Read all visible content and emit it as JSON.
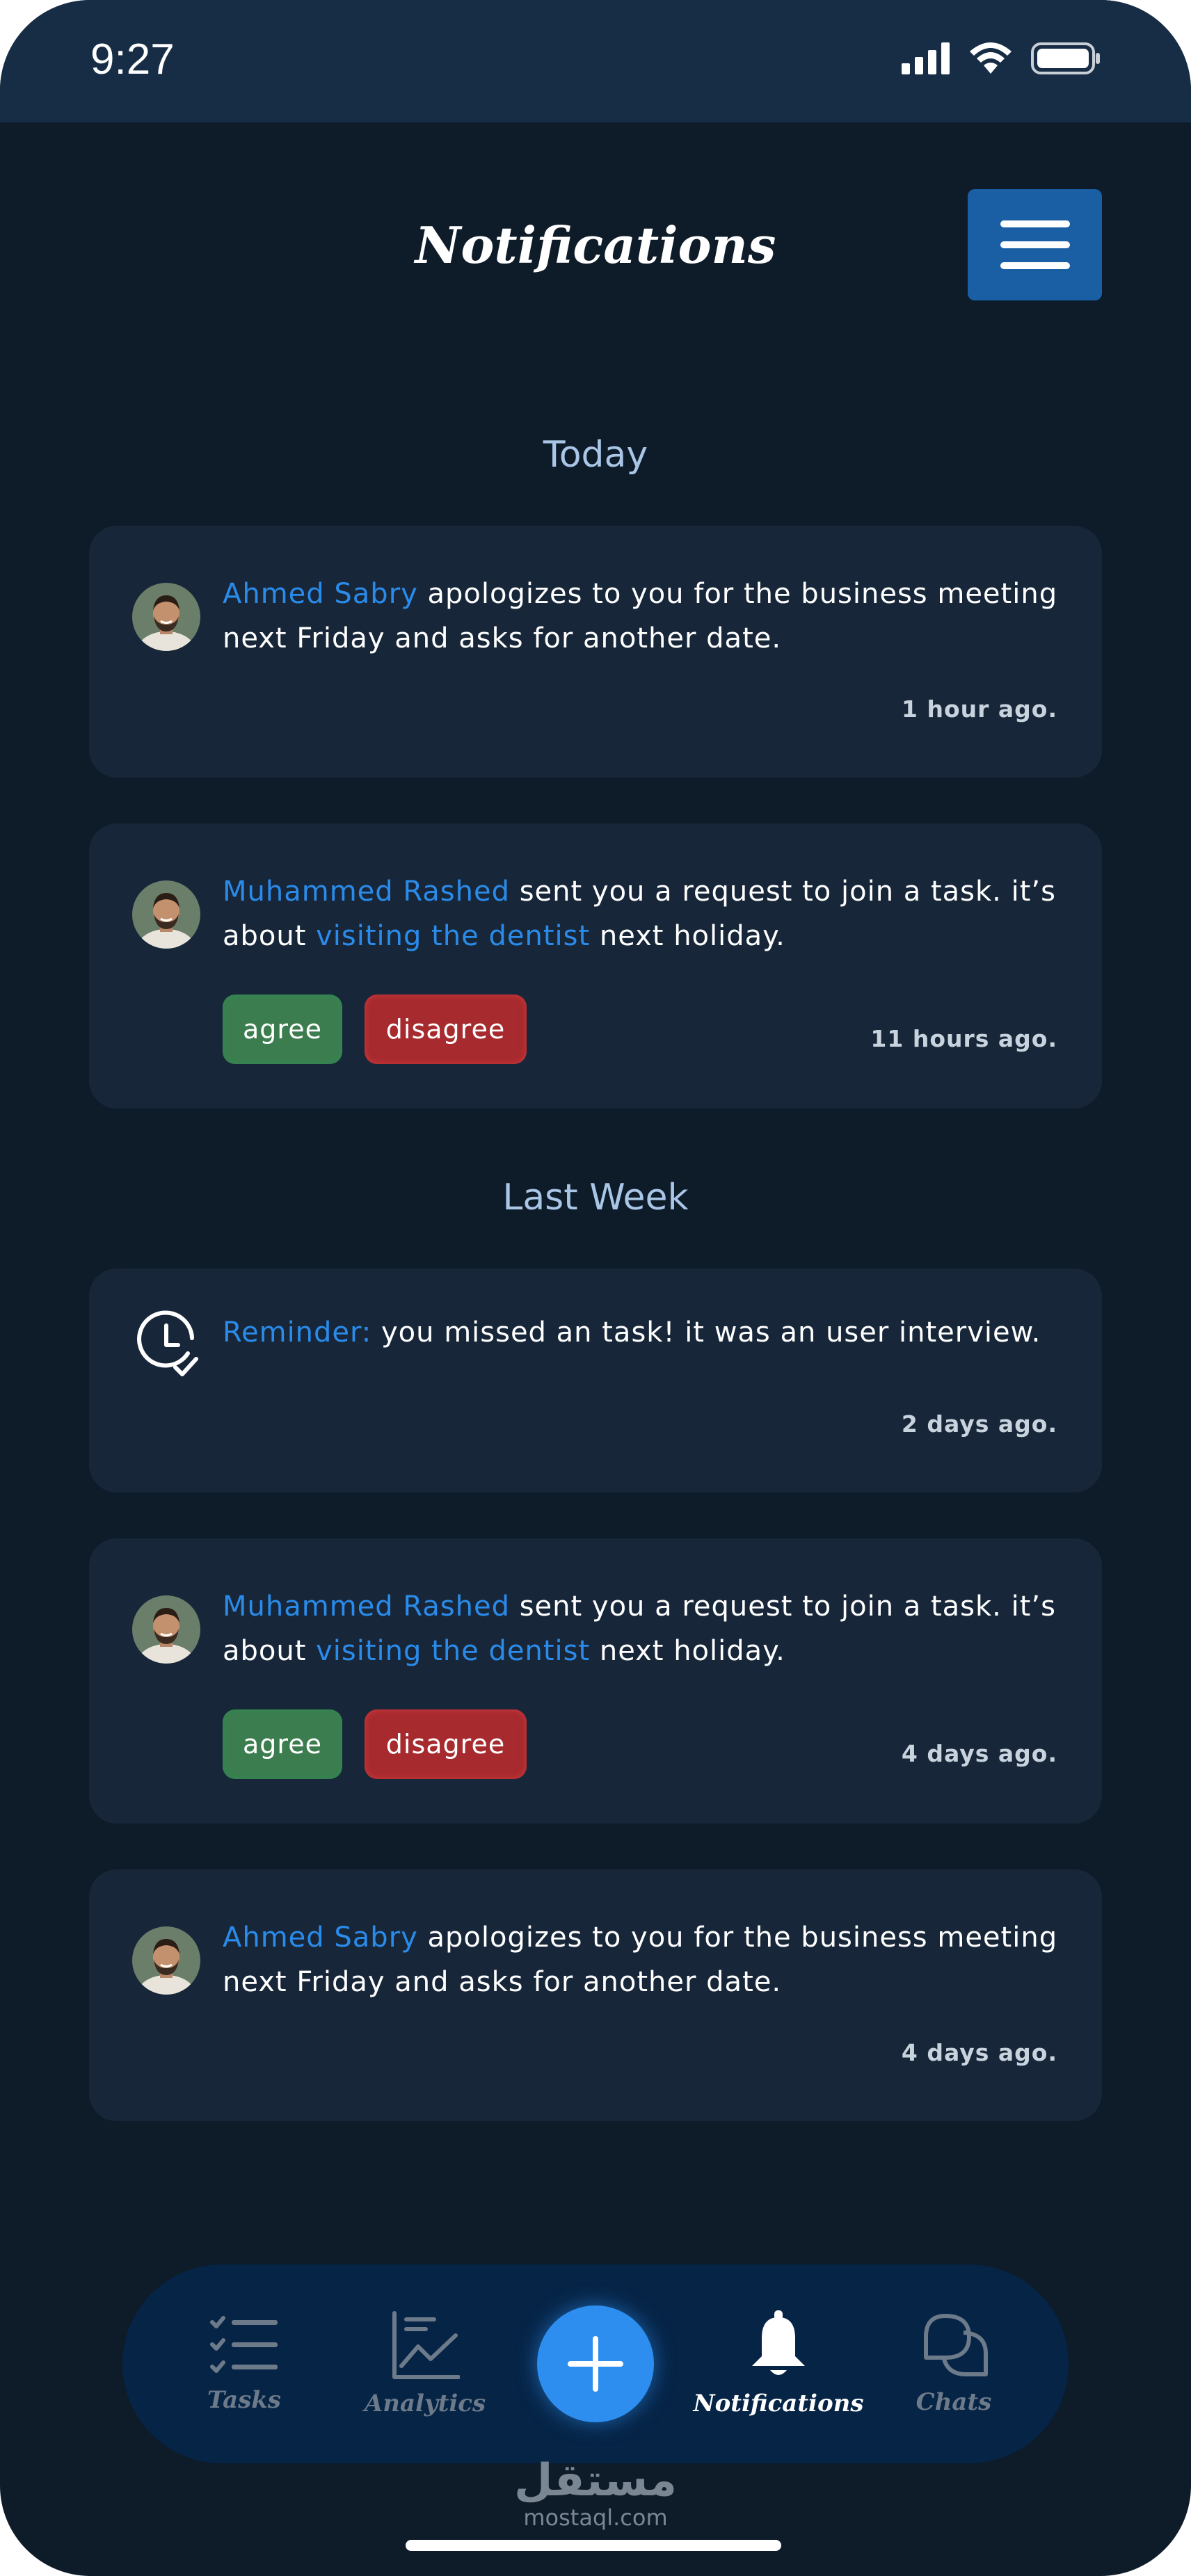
{
  "status_bar": {
    "time": "9:27"
  },
  "header": {
    "title": "Notifications"
  },
  "sections": {
    "today": "Today",
    "last_week": "Last Week"
  },
  "notifications": [
    {
      "name": "Ahmed Sabry",
      "text": " apologizes to you for the business meeting next Friday and asks for another date.",
      "time": "1 hour ago."
    },
    {
      "name": "Muhammed Rashed",
      "text_a": " sent you a request to join a task. it’s about ",
      "link": "visiting the dentist",
      "text_b": " next holiday.",
      "agree": "agree",
      "disagree": "disagree",
      "time": "11 hours ago."
    },
    {
      "label": "Reminder:",
      "text": " you missed an task! it was an user interview.",
      "time": "2 days ago."
    },
    {
      "name": "Muhammed Rashed",
      "text_a": " sent you a request to join a task. it’s about ",
      "link": "visiting the dentist",
      "text_b": " next holiday.",
      "agree": "agree",
      "disagree": "disagree",
      "time": "4 days ago."
    },
    {
      "name": "Ahmed Sabry",
      "text": " apologizes to you for the business meeting next Friday and asks for another date.",
      "time": "4 days ago."
    }
  ],
  "nav": {
    "tasks": "Tasks",
    "analytics": "Analytics",
    "notifications": "Notifications",
    "chats": "Chats",
    "active": "notifications"
  },
  "watermark": {
    "arabic": "مستقل",
    "latin": "mostaql.com"
  },
  "colors": {
    "background": "#0e1b29",
    "card": "#172739",
    "accent": "#2a8bea",
    "agree": "#3c7d4f",
    "disagree": "#a62a2e",
    "nav": "#062446"
  },
  "icons": [
    "signal-icon",
    "wifi-icon",
    "battery-icon",
    "menu-icon",
    "avatar",
    "clock-check-icon",
    "tasks-icon",
    "analytics-icon",
    "plus-icon",
    "bell-icon",
    "chats-icon"
  ]
}
